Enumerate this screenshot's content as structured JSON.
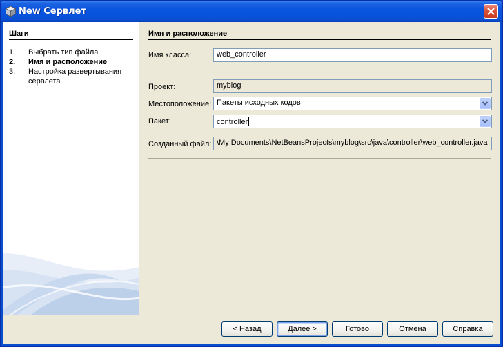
{
  "window": {
    "title": "New Сервлет",
    "icons": {
      "title": "cube-icon",
      "close": "close-icon"
    },
    "accent": "#0a55df"
  },
  "steps": {
    "heading": "Шаги",
    "items": [
      {
        "number": "1.",
        "label": "Выбрать тип файла",
        "current": false
      },
      {
        "number": "2.",
        "label": "Имя и расположение",
        "current": true
      },
      {
        "number": "3.",
        "label": "Настройка развертывания сервлета",
        "current": false
      }
    ]
  },
  "form": {
    "heading": "Имя и расположение",
    "class_name_label": "Имя класса:",
    "class_name_value": "web_controller",
    "project_label": "Проект:",
    "project_value": "myblog",
    "location_label": "Местоположение:",
    "location_value": "Пакеты исходных кодов",
    "package_label": "Пакет:",
    "package_value": "controller",
    "created_file_label": "Созданный файл:",
    "created_file_value": "\\My Documents\\NetBeansProjects\\myblog\\src\\java\\controller\\web_controller.java"
  },
  "buttons": {
    "back": "< Назад",
    "next": "Далее >",
    "finish": "Готово",
    "cancel": "Отмена",
    "help": "Справка"
  }
}
